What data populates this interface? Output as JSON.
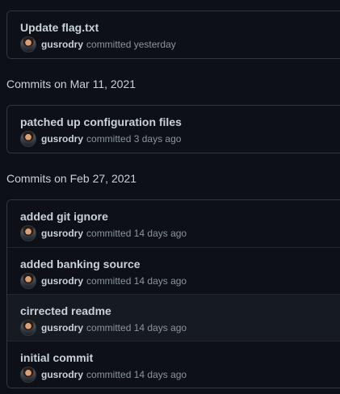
{
  "groups": [
    {
      "header": "",
      "commits": [
        {
          "title": "Update flag.txt",
          "author": "gusrodry",
          "action": "committed",
          "when": "yesterday"
        }
      ]
    },
    {
      "header": "Commits on Mar 11, 2021",
      "commits": [
        {
          "title": "patched up configuration files",
          "author": "gusrodry",
          "action": "committed",
          "when": "3 days ago"
        }
      ]
    },
    {
      "header": "Commits on Feb 27, 2021",
      "commits": [
        {
          "title": "added git ignore",
          "author": "gusrodry",
          "action": "committed",
          "when": "14 days ago"
        },
        {
          "title": "added banking source",
          "author": "gusrodry",
          "action": "committed",
          "when": "14 days ago"
        },
        {
          "title": "cirrected readme",
          "author": "gusrodry",
          "action": "committed",
          "when": "14 days ago"
        },
        {
          "title": "initial commit",
          "author": "gusrodry",
          "action": "committed",
          "when": "14 days ago"
        }
      ]
    }
  ]
}
